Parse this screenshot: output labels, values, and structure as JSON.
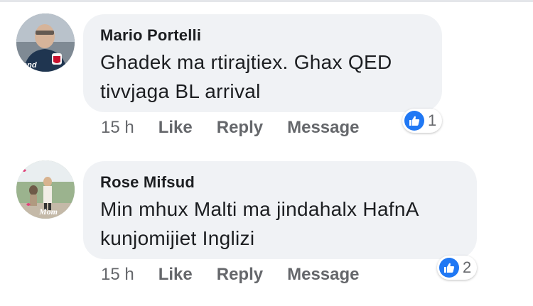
{
  "comments": [
    {
      "author": "Mario Portelli",
      "text_lines": [
        "Ghadek ma rtirajtiex. Ghax QED",
        "tivvjaga BL arrival"
      ],
      "avatar_caption": "land",
      "time": "15 h",
      "actions": {
        "like": "Like",
        "reply": "Reply",
        "message": "Message"
      },
      "reactions": {
        "icon": "thumbs-up-icon",
        "count": "1"
      }
    },
    {
      "author": "Rose Mifsud",
      "text_lines": [
        "Min mhux Malti ma jindahalx HafnA",
        "kunjomijiet Inglizi"
      ],
      "avatar_caption": "Mom",
      "time": "15 h",
      "actions": {
        "like": "Like",
        "reply": "Reply",
        "message": "Message"
      },
      "reactions": {
        "icon": "thumbs-up-icon",
        "count": "2"
      }
    }
  ],
  "colors": {
    "bubble": "#f0f2f5",
    "like_blue": "#2078f4",
    "meta_text": "#65676b",
    "primary_text": "#1c1e21"
  }
}
